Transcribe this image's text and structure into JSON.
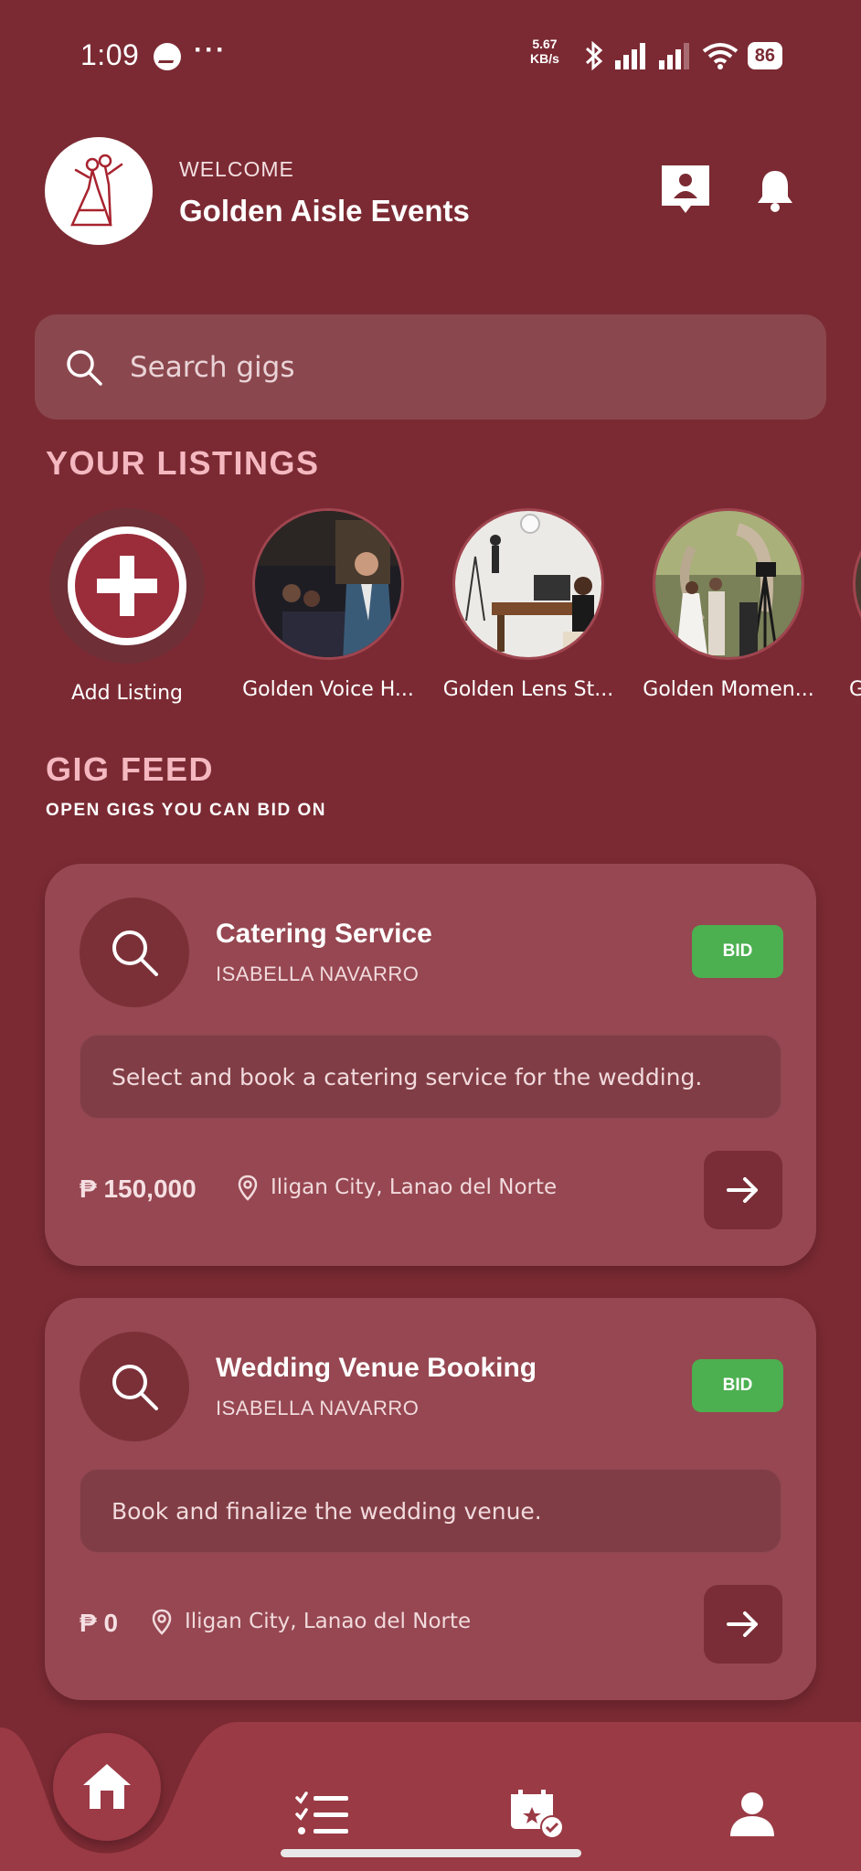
{
  "status_bar": {
    "time": "1:09",
    "speed_value": "5.67",
    "speed_unit": "KB/s",
    "battery": "86"
  },
  "header": {
    "welcome": "WELCOME",
    "business_name": "Golden Aisle Events"
  },
  "search": {
    "placeholder": "Search gigs"
  },
  "listings": {
    "title": "YOUR LISTINGS",
    "add_label": "Add Listing",
    "items": [
      {
        "label": "Golden Voice H..."
      },
      {
        "label": "Golden Lens St..."
      },
      {
        "label": "Golden Momen..."
      },
      {
        "label": "G"
      }
    ]
  },
  "gig_feed": {
    "title": "GIG FEED",
    "subtitle": "OPEN GIGS YOU CAN BID ON",
    "gigs": [
      {
        "title": "Catering Service",
        "client": "ISABELLA NAVARRO",
        "bid_label": "BID",
        "description": "Select and book a catering service for the wedding.",
        "price": "₱ 150,000",
        "location": "Iligan City, Lanao del Norte"
      },
      {
        "title": "Wedding Venue Booking",
        "client": "ISABELLA NAVARRO",
        "bid_label": "BID",
        "description": "Book and finalize the wedding venue.",
        "price": "₱ 0",
        "location": "Iligan City, Lanao del Norte"
      }
    ]
  },
  "nav": {
    "items": [
      "home-icon",
      "tasks-list-icon",
      "event-calendar-icon",
      "profile-icon"
    ]
  },
  "colors": {
    "background": "#7b2a33",
    "card": "#964751",
    "accent_pink": "#f5b8c0",
    "bid_green": "#4caf50"
  }
}
